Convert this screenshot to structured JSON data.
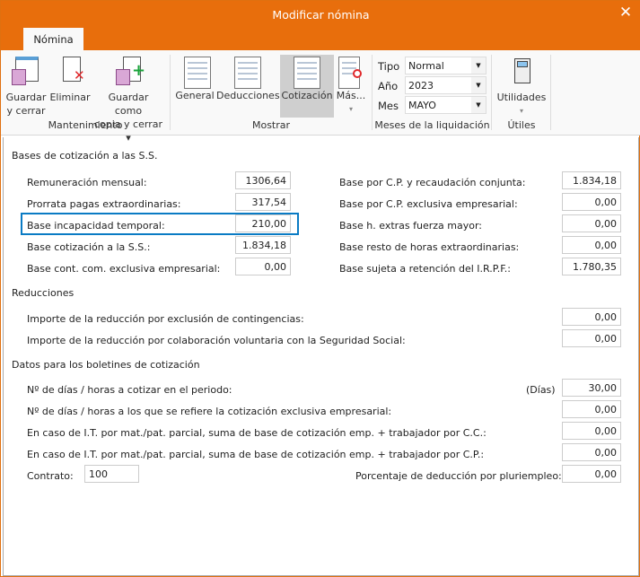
{
  "window": {
    "title": "Modificar nómina",
    "close": "✕"
  },
  "tabs": [
    {
      "label": "Nómina"
    }
  ],
  "ribbon": {
    "mantenimiento": {
      "label": "Mantenimiento",
      "guardar": "Guardar\ny cerrar",
      "guardar_l1": "Guardar",
      "guardar_l2": "y cerrar",
      "eliminar": "Eliminar",
      "copia_l1": "Guardar como",
      "copia_l2": "copia y cerrar ▾"
    },
    "mostrar": {
      "label": "Mostrar",
      "general": "General",
      "deducciones": "Deducciones",
      "cotizacion": "Cotización",
      "mas": "Más...",
      "mas_arrow": "▾"
    },
    "meses": {
      "label": "Meses de la liquidación",
      "tipo_label": "Tipo",
      "tipo": "Normal",
      "anio_label": "Año",
      "anio": "2023",
      "mes_label": "Mes",
      "mes": "MAYO"
    },
    "utiles": {
      "label": "Útiles",
      "utilidades": "Utilidades",
      "arrow": "▾"
    }
  },
  "bases": {
    "title": "Bases de cotización a las S.S.",
    "left": [
      {
        "label": "Remuneración mensual:",
        "value": "1306,64"
      },
      {
        "label": "Prorrata pagas extraordinarias:",
        "value": "317,54"
      },
      {
        "label": "Base incapacidad temporal:",
        "value": "210,00"
      },
      {
        "label": "Base cotización a la S.S.:",
        "value": "1.834,18"
      },
      {
        "label": "Base cont. com. exclusiva empresarial:",
        "value": "0,00"
      }
    ],
    "right": [
      {
        "label": "Base por C.P. y recaudación conjunta:",
        "value": "1.834,18"
      },
      {
        "label": "Base por C.P. exclusiva empresarial:",
        "value": "0,00"
      },
      {
        "label": "Base h. extras fuerza mayor:",
        "value": "0,00"
      },
      {
        "label": "Base resto de horas extraordinarias:",
        "value": "0,00"
      },
      {
        "label": "Base sujeta a retención del I.R.P.F.:",
        "value": "1.780,35"
      }
    ]
  },
  "reducciones": {
    "title": "Reducciones",
    "rows": [
      {
        "label": "Importe de la reducción por exclusión de contingencias:",
        "value": "0,00"
      },
      {
        "label": "Importe de la reducción por colaboración voluntaria con la Seguridad Social:",
        "value": "0,00"
      }
    ]
  },
  "boletines": {
    "title": "Datos para los boletines de cotización",
    "dias": "(Días)",
    "rows": [
      {
        "label": "Nº de días / horas a cotizar en el periodo:",
        "value": "30,00"
      },
      {
        "label": "Nº de días / horas a los que se refiere la cotización exclusiva empresarial:",
        "value": "0,00"
      },
      {
        "label": "En caso de I.T. por mat./pat. parcial, suma de base de cotización emp. + trabajador por C.C.:",
        "value": "0,00"
      },
      {
        "label": "En caso de I.T. por mat./pat. parcial, suma de base de cotización emp. + trabajador por C.P.:",
        "value": "0,00"
      }
    ],
    "contrato_label": "Contrato:",
    "contrato": "100",
    "pluri_label": "Porcentaje de deducción por pluriempleo:",
    "pluri": "0,00"
  },
  "colors": {
    "accent": "#E86E0C",
    "focus": "#0A7BC4"
  }
}
